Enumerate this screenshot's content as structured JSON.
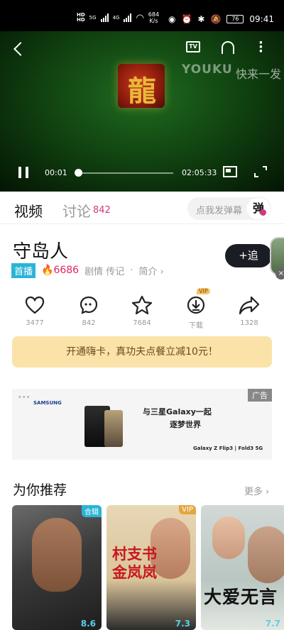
{
  "status": {
    "net_speed": "684",
    "net_unit": "K/s",
    "gen1": "5G",
    "gen2": "4G",
    "battery": "76",
    "time": "09:41"
  },
  "player": {
    "watermark": "YOUKU",
    "watermark2": "快来一发",
    "current_time": "00:01",
    "total_time": "02:05:33",
    "progress": 0.0
  },
  "tabs": {
    "video": "视频",
    "discuss": "讨论",
    "discuss_count": "842"
  },
  "danmu": {
    "placeholder": "点我发弹幕",
    "button": "弹"
  },
  "show": {
    "title": "守岛人",
    "follow": "+追",
    "badge": "首播",
    "heat": "6686",
    "genres": "剧情 传记",
    "intro": "简介"
  },
  "actions": [
    {
      "name": "like",
      "label": "3477"
    },
    {
      "name": "comment",
      "label": "842"
    },
    {
      "name": "favorite",
      "label": "7684"
    },
    {
      "name": "download",
      "label": "下载",
      "vip": "VIP"
    },
    {
      "name": "share",
      "label": "1328"
    }
  ],
  "promo": {
    "text": "开通嗨卡，真功夫点餐立减10元！"
  },
  "ad": {
    "tag": "广告",
    "brand": "SAMSUNG",
    "headline": "与三星Galaxy一起",
    "sub": "逐梦世界",
    "model": "Galaxy Z Flip3 | Fold3 5G"
  },
  "recommend": {
    "title": "为你推荐",
    "more": "更多",
    "cards": [
      {
        "tag": "合辑",
        "tag_color": "#2ab4d6",
        "score": "8.6"
      },
      {
        "tag": "VIP",
        "tag_color": "#e3a640",
        "title_text": "村支书金岚岚",
        "score": "7.3"
      },
      {
        "title_text": "大爱无言",
        "score": "7.7"
      }
    ]
  }
}
